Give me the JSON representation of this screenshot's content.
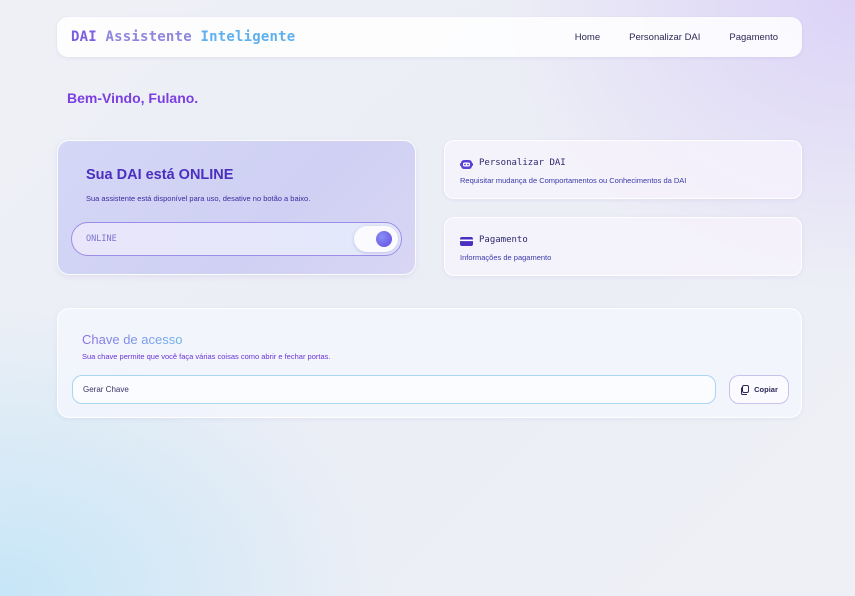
{
  "navbar": {
    "brand_part1": "DAI",
    "brand_part2": "Assistente",
    "brand_part3": "Inteligente",
    "links": [
      "Home",
      "Personalizar DAI",
      "Pagamento"
    ]
  },
  "welcome": "Bem-Vindo, Fulano.",
  "status": {
    "title": "Sua DAI está ONLINE",
    "description": "Sua assistente está disponível para uso, desative no botão a baixo.",
    "toggle_label": "ONLINE",
    "toggle_on": true
  },
  "cards": [
    {
      "title": "Personalizar DAI",
      "description": "Requisitar mudança de Comportamentos ou Conhecimentos da DAI",
      "icon": "robot-face-icon"
    },
    {
      "title": "Pagamento",
      "description": "Informações de pagamento",
      "icon": "credit-card-icon"
    }
  ],
  "access_key": {
    "title": "Chave de acesso",
    "description": "Sua chave permite que você faça várias coisas como abrir e fechar portas.",
    "input_value": "Gerar Chave",
    "copy_label": "Copiar"
  },
  "colors": {
    "accent": "#7a3fe0",
    "brand_purple": "#7b5fe0",
    "brand_blue": "#5fb0ee",
    "toggle_knob": "#6b5fe8"
  }
}
